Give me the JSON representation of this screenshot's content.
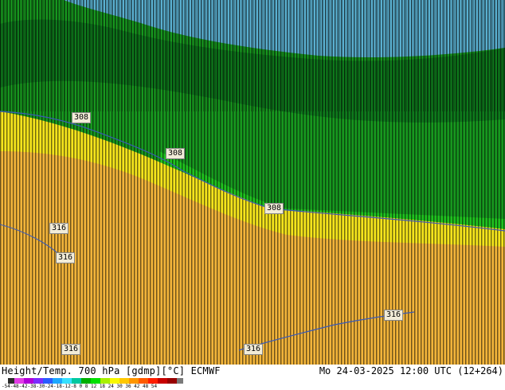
{
  "map": {
    "contour_labels": [
      "308",
      "308",
      "308",
      "316",
      "316",
      "316",
      "316",
      "316"
    ]
  },
  "footer": {
    "title_left": "Height/Temp. 700 hPa [gdmp][°C] ECMWF",
    "title_right": "Mo 24-03-2025 12:00 UTC (12+264)",
    "legend_values": "-54-48-42-38-30-24-18-12-8  0  8 12 18 24 30 36 42 48 54",
    "legend_colors": [
      "#2b2b2b",
      "#e23ce6",
      "#b000d8",
      "#7a2cff",
      "#2a5cff",
      "#1ca8ff",
      "#36e0ff",
      "#00c8a0",
      "#00b000",
      "#00e000",
      "#a8f000",
      "#f8f800",
      "#ffc800",
      "#ff9600",
      "#ff5a00",
      "#ff1e00",
      "#c80000",
      "#960000",
      "#7a7a7a"
    ]
  },
  "colors": {
    "sky_blue": "#6ab6d6",
    "dark_green": "#0a6a1a",
    "green": "#17981f",
    "bright_green": "#1fc21f",
    "yellow": "#f4e41c",
    "orange": "#f2b43a",
    "contour_blue": "#3a5ab8"
  }
}
